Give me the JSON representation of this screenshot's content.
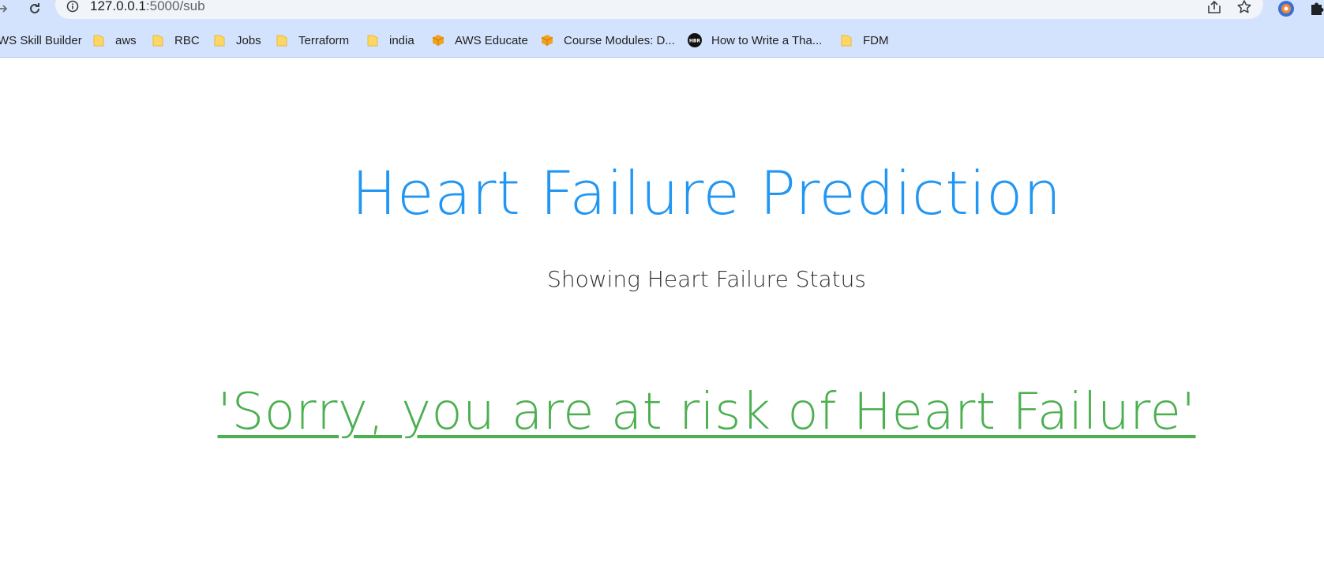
{
  "browser": {
    "url_host": "127.0.0.1",
    "url_path": ":5000/sub",
    "bookmarks": [
      {
        "label": "WS Skill Builder",
        "icon": "none"
      },
      {
        "label": "aws",
        "icon": "folder-icon"
      },
      {
        "label": "RBC",
        "icon": "folder-icon"
      },
      {
        "label": "Jobs",
        "icon": "folder-icon"
      },
      {
        "label": "Terraform",
        "icon": "folder-icon"
      },
      {
        "label": "india",
        "icon": "folder-icon"
      },
      {
        "label": "AWS Educate",
        "icon": "aws-box-icon"
      },
      {
        "label": "Course Modules: D...",
        "icon": "aws-box-icon"
      },
      {
        "label": "How to Write a Tha...",
        "icon": "hbr-icon"
      },
      {
        "label": "FDM",
        "icon": "folder-icon"
      }
    ],
    "colors": {
      "toolbar": "#d3e3fd",
      "omnibox": "#f1f4f9",
      "folder": "#fdd663",
      "aws_box": "#f2a31b"
    }
  },
  "page": {
    "title": "Heart Failure Prediction",
    "subtitle": "Showing Heart Failure Status",
    "result": "'Sorry, you are at risk of Heart Failure'",
    "colors": {
      "title": "#2196f3",
      "subtitle": "#333333",
      "result": "#4caf50"
    }
  }
}
